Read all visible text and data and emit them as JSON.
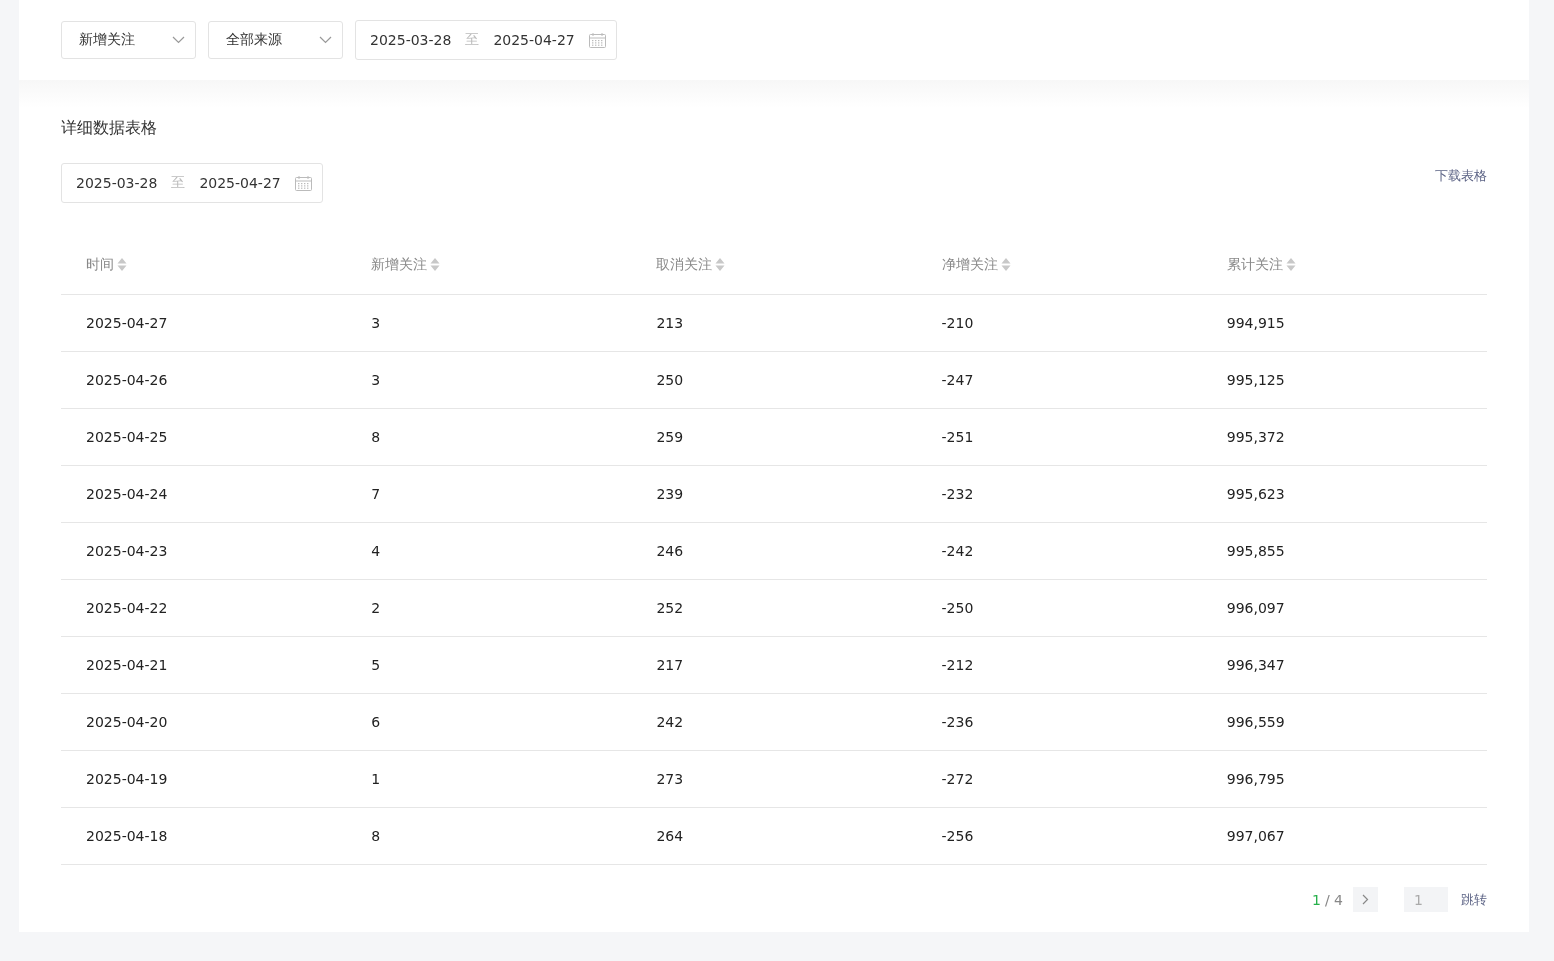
{
  "filters": {
    "selects": [
      {
        "value": "新增关注"
      },
      {
        "value": "全部来源"
      }
    ],
    "date_range": {
      "start": "2025-03-28",
      "separator": "至",
      "end": "2025-04-27"
    }
  },
  "table_section": {
    "title": "详细数据表格",
    "date_range": {
      "start": "2025-03-28",
      "separator": "至",
      "end": "2025-04-27"
    },
    "download_link": "下载表格",
    "table": {
      "columns": [
        "时间",
        "新增关注",
        "取消关注",
        "净增关注",
        "累计关注"
      ],
      "rows": [
        [
          "2025-04-27",
          "3",
          "213",
          "-210",
          "994,915"
        ],
        [
          "2025-04-26",
          "3",
          "250",
          "-247",
          "995,125"
        ],
        [
          "2025-04-25",
          "8",
          "259",
          "-251",
          "995,372"
        ],
        [
          "2025-04-24",
          "7",
          "239",
          "-232",
          "995,623"
        ],
        [
          "2025-04-23",
          "4",
          "246",
          "-242",
          "995,855"
        ],
        [
          "2025-04-22",
          "2",
          "252",
          "-250",
          "996,097"
        ],
        [
          "2025-04-21",
          "5",
          "217",
          "-212",
          "996,347"
        ],
        [
          "2025-04-20",
          "6",
          "242",
          "-236",
          "996,559"
        ],
        [
          "2025-04-19",
          "1",
          "273",
          "-272",
          "996,795"
        ],
        [
          "2025-04-18",
          "8",
          "264",
          "-256",
          "997,067"
        ]
      ]
    },
    "pagination": {
      "current": "1",
      "total": "/ 4",
      "jump_placeholder": "1",
      "jump_label": "跳转"
    }
  }
}
